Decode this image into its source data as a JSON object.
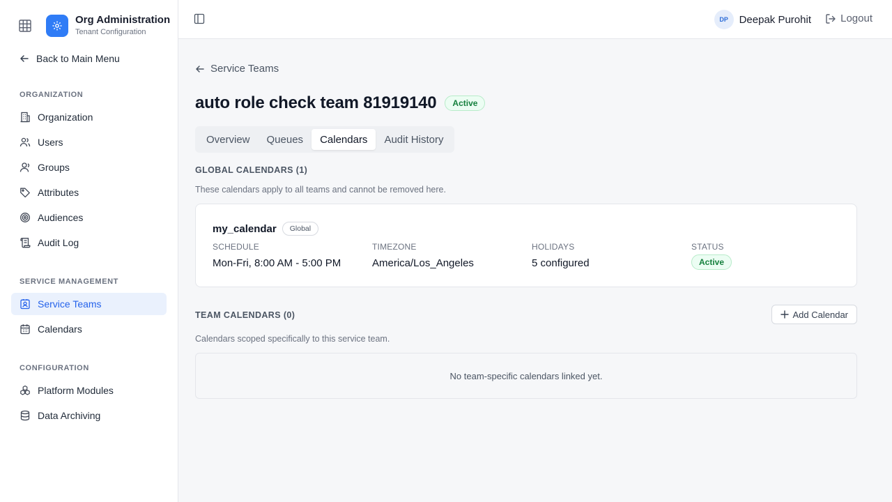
{
  "brand": {
    "title": "Org Administration",
    "subtitle": "Tenant Configuration",
    "icons": [
      "grid-icon",
      "gear-icon"
    ],
    "accent": "#2f7cf6"
  },
  "sidebar": {
    "back_label": "Back to Main Menu",
    "sections": {
      "organization": "ORGANIZATION",
      "service_management": "SERVICE MANAGEMENT",
      "configuration": "CONFIGURATION"
    },
    "items": {
      "organization": "Organization",
      "users": "Users",
      "groups": "Groups",
      "attributes": "Attributes",
      "audiences": "Audiences",
      "audit_log": "Audit Log",
      "service_teams": "Service Teams",
      "calendars": "Calendars",
      "platform_modules": "Platform Modules",
      "data_archiving": "Data Archiving"
    },
    "active_item": "service_teams"
  },
  "header": {
    "user_initials": "DP",
    "user_name": "Deepak Purohit",
    "logout_label": "Logout"
  },
  "page": {
    "breadcrumb": "Service Teams",
    "title": "auto role check team 81919140",
    "status": "Active",
    "tabs": [
      "Overview",
      "Queues",
      "Calendars",
      "Audit History"
    ],
    "active_tab": "Calendars"
  },
  "global_calendars": {
    "heading": "GLOBAL CALENDARS (1)",
    "description": "These calendars apply to all teams and cannot be removed here.",
    "calendar": {
      "name": "my_calendar",
      "scope_badge": "Global",
      "schedule_label": "SCHEDULE",
      "schedule_value": "Mon-Fri, 8:00 AM - 5:00 PM",
      "timezone_label": "TIMEZONE",
      "timezone_value": "America/Los_Angeles",
      "holidays_label": "HOLIDAYS",
      "holidays_value": "5 configured",
      "status_label": "STATUS",
      "status_value": "Active"
    }
  },
  "team_calendars": {
    "heading": "TEAM CALENDARS (0)",
    "description": "Calendars scoped specifically to this service team.",
    "add_label": "Add Calendar",
    "empty_text": "No team-specific calendars linked yet."
  },
  "colors": {
    "active_nav_bg": "#eaf1fd",
    "active_nav_text": "#2563eb",
    "status_green": "#15803d"
  }
}
